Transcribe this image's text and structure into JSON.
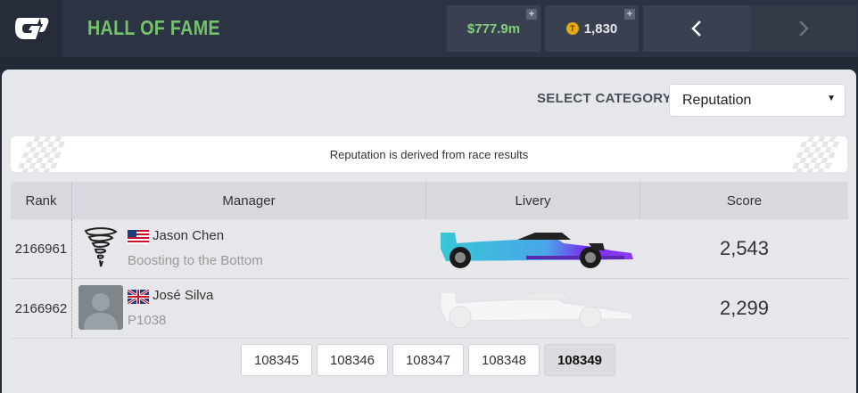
{
  "header": {
    "title": "HALL OF FAME",
    "money": "$777.9m",
    "tokens": "1,830",
    "plus_symbol": "+",
    "token_symbol": "T"
  },
  "category": {
    "label": "SELECT CATEGORY",
    "selected": "Reputation"
  },
  "info_text": "Reputation is derived from race results",
  "table": {
    "columns": [
      "Rank",
      "Manager",
      "Livery",
      "Score"
    ],
    "rows": [
      {
        "rank": "2166961",
        "name": "Jason Chen",
        "team": "Boosting to the Bottom",
        "score": "2,543",
        "flag": "us-flag-icon",
        "avatar": "tornado-icon"
      },
      {
        "rank": "2166962",
        "name": "José Silva",
        "team": "P1038",
        "score": "2,299",
        "flag": "uk-flag-icon",
        "avatar": "default-person-icon"
      }
    ]
  },
  "pagination": {
    "pages": [
      "108345",
      "108346",
      "108347",
      "108348",
      "108349"
    ],
    "current": "108349"
  },
  "colors": {
    "accent_green": "#74c26c",
    "money_green": "#84d07c",
    "livery_cyan": "#37c6d6",
    "livery_purple": "#7a2cf0"
  }
}
